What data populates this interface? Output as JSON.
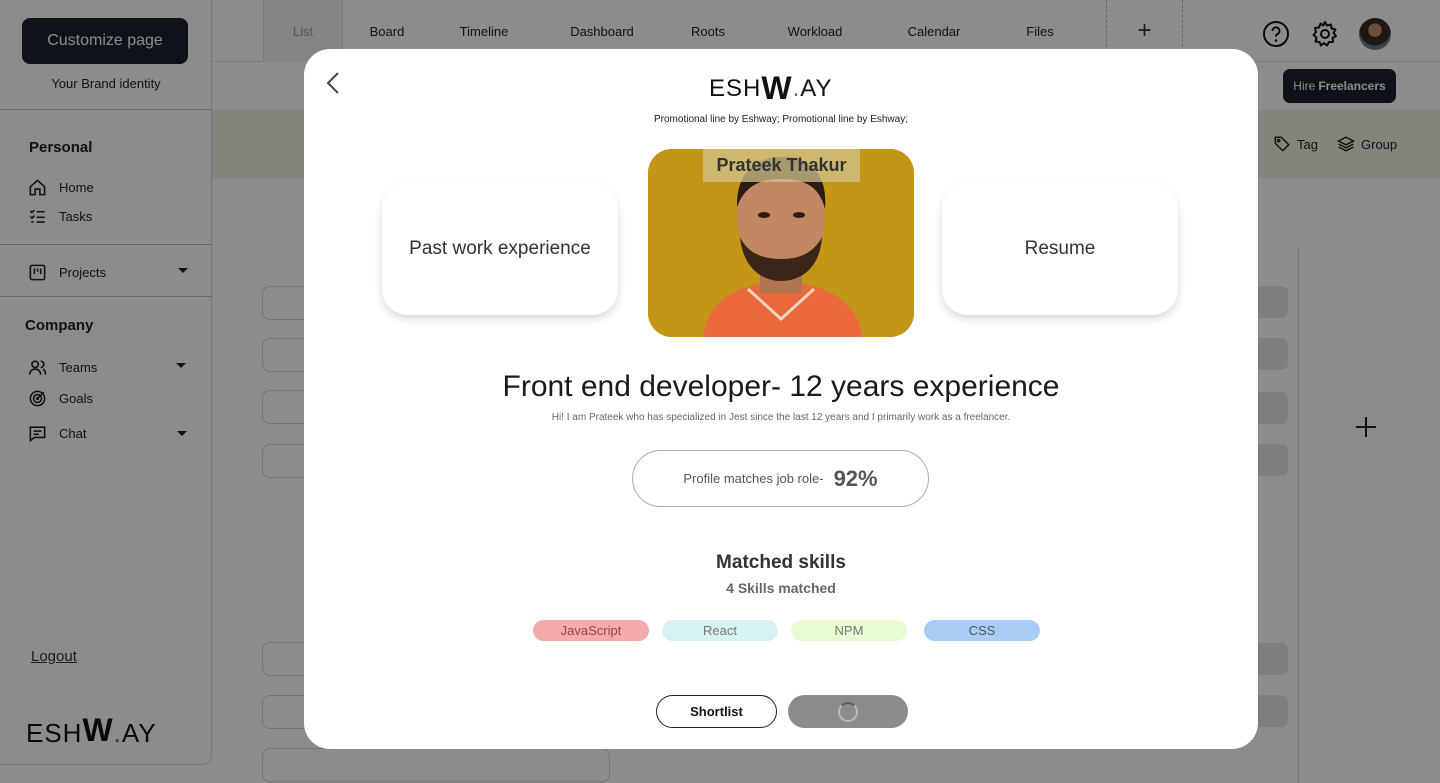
{
  "sidebar": {
    "customize_label": "Customize page",
    "brand_identity": "Your Brand identity",
    "personal_heading": "Personal",
    "home": "Home",
    "tasks": "Tasks",
    "projects": "Projects",
    "company_heading": "Company",
    "teams": "Teams",
    "goals": "Goals",
    "chat": "Chat",
    "logout": "Logout",
    "logo": {
      "part1": "ESH",
      "w": "W",
      "dot": ".",
      "part2": "AY"
    }
  },
  "topbar": {
    "tabs": [
      "List",
      "Board",
      "Timeline",
      "Dashboard",
      "Roots",
      "Workload",
      "Calendar",
      "Files"
    ],
    "add_tab": "+"
  },
  "subbar": {
    "hire_prefix": "Hire",
    "hire_bold": "Freelancers",
    "tag": "Tag",
    "group": "Group"
  },
  "modal": {
    "logo": {
      "part1": "ESH",
      "w": "W",
      "dot": ".",
      "part2": "AY"
    },
    "promo": "Promotional line by Eshway; Promotional line by Eshway;",
    "past_work": "Past work experience",
    "resume": "Resume",
    "candidate_name": "Prateek Thakur",
    "role_title": "Front end developer- 12 years experience",
    "bio": "Hi! I am Prateek who has specialized in Jest since the last 12 years and I primarily work as a freelancer.",
    "match_label": "Profile matches job role-",
    "match_value": "92%",
    "skills_title": "Matched skills",
    "skills_count": "4 Skills matched",
    "skills": [
      {
        "label": "JavaScript",
        "bg": "#f6aaaa",
        "fg": "#8a4a4a"
      },
      {
        "label": "React",
        "bg": "#d7f3f1",
        "fg": "#777777"
      },
      {
        "label": "NPM",
        "bg": "#e8fbd3",
        "fg": "#777777"
      },
      {
        "label": "CSS",
        "bg": "#a7cdf7",
        "fg": "#555555"
      }
    ],
    "shortlist": "Shortlist"
  },
  "colors": {
    "dark": "#1b2330",
    "accent": "#8e44ad"
  }
}
